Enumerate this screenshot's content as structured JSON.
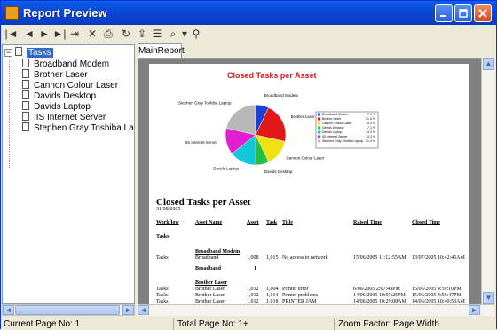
{
  "window": {
    "title": "Report Preview",
    "icon": "report-app-icon"
  },
  "toolbar": {
    "buttons": [
      {
        "name": "first-page-icon",
        "glyph": "|◄"
      },
      {
        "name": "previous-page-icon",
        "glyph": "◄"
      },
      {
        "name": "next-page-icon",
        "glyph": "►"
      },
      {
        "name": "last-page-icon",
        "glyph": "►|"
      },
      {
        "name": "goto-page-icon",
        "glyph": "⇥"
      },
      {
        "name": "close-report-icon",
        "glyph": "✕"
      },
      {
        "name": "print-icon",
        "glyph": "⎙"
      },
      {
        "name": "refresh-icon",
        "glyph": "↻"
      },
      {
        "name": "export-icon",
        "glyph": "⇪"
      },
      {
        "name": "toggle-tree-icon",
        "glyph": "☰"
      },
      {
        "name": "zoom-icon",
        "glyph": "⌕"
      },
      {
        "name": "zoom-dropdown-icon",
        "glyph": "▾"
      },
      {
        "name": "search-icon",
        "glyph": "⚲"
      }
    ]
  },
  "tree": {
    "root": "Tasks",
    "items": [
      "Broadband Modem",
      "Brother Laser",
      "Cannon Colour Laser",
      "Davids Desktop",
      "Davids Laptop",
      "IIS Internet Server",
      "Stephen Gray Toshiba Lapto"
    ]
  },
  "tabs": [
    {
      "label": "MainReport"
    }
  ],
  "report": {
    "chart_title": "Closed Tasks per Asset",
    "title": "Closed Tasks per Asset",
    "date": "31/08/2005",
    "columns": [
      "Workflow",
      "Asset Name",
      "Asset",
      "Task",
      "Title",
      "Raised Time",
      "Closed Time"
    ],
    "group_header": "Tasks",
    "groups": [
      {
        "name": "Broadband Modem",
        "rows": [
          {
            "workflow": "Tasks",
            "asset_name": "Broadband",
            "asset": "1,008",
            "task": "1,015",
            "title": "No access to network",
            "raised": "15/06/2005 11:12:55AM",
            "closed": "13/07/2005 10:42:45AM"
          }
        ],
        "subtotal_label": "Broadband",
        "subtotal": "1"
      },
      {
        "name": "Brother Laser",
        "rows": [
          {
            "workflow": "Tasks",
            "asset_name": "Brother Laser",
            "asset": "1,012",
            "task": "1,004",
            "title": "Printer error",
            "raised": "6/06/2005 2:07:43PM",
            "closed": "15/06/2005 4:59:10PM"
          },
          {
            "workflow": "Tasks",
            "asset_name": "Brother Laser",
            "asset": "1,012",
            "task": "1,014",
            "title": "Printer problems",
            "raised": "14/06/2005 10:07:25PM",
            "closed": "15/06/2005 4:56:47PM"
          },
          {
            "workflow": "Tasks",
            "asset_name": "Brother Laser",
            "asset": "1,012",
            "task": "1,018",
            "title": "PRINTER JAM",
            "raised": "14/06/2005 10:29:08AM",
            "closed": "14/06/2005 10:40:53AM"
          }
        ]
      }
    ]
  },
  "chart_data": {
    "type": "pie",
    "title": "Closed Tasks per Asset",
    "categories": [
      "Broadband Modem",
      "Brother Laser",
      "Cannon Colour Laser",
      "Davids Desktop",
      "Davids Laptop",
      "IIS Internet Server",
      "Stephen Gray Toshiba Laptop"
    ],
    "values": [
      7.1,
      21.4,
      14.3,
      7.1,
      14.3,
      14.3,
      21.4
    ],
    "colors": [
      "#1c3fd8",
      "#e01818",
      "#f0e010",
      "#20c040",
      "#10c8d8",
      "#e020d0",
      "#b8b8b8"
    ],
    "labels": [
      "Broadband Modem",
      "Brother Laser",
      "Cannon Colour Laser",
      "Davids Desktop",
      "Davids Laptop",
      "IIS Internet Server",
      "Stephen Gray Toshiba Laptop"
    ]
  },
  "status": {
    "current_page": "Current Page No: 1",
    "total_page": "Total Page No: 1+",
    "zoom": "Zoom Factor: Page Width"
  },
  "colors": {
    "titlebar": "#0a48d8",
    "selection": "#316ac5",
    "viewer_bg": "#808080"
  }
}
